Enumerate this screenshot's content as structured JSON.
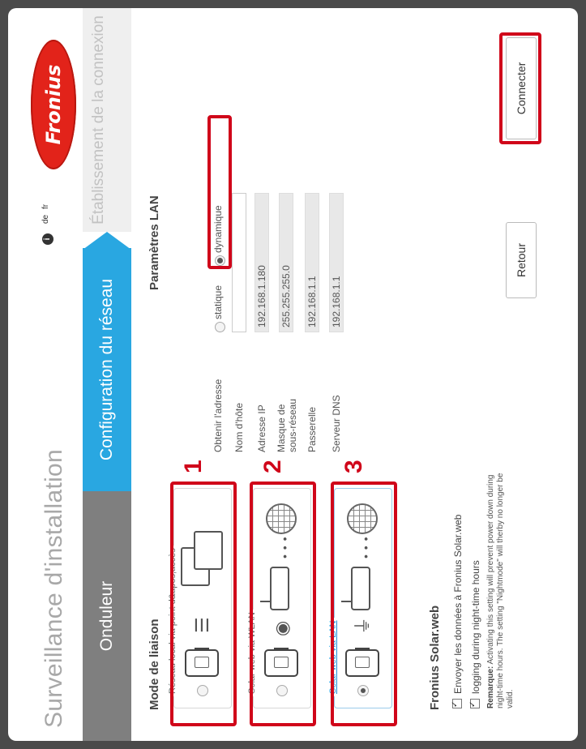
{
  "header": {
    "title": "Surveillance d'installation",
    "info_icon": "info-icon",
    "languages": [
      "de",
      "fr"
    ],
    "logo_text": "Fronius"
  },
  "tabs": {
    "inverter": "Onduleur",
    "network_config": "Configuration du réseau",
    "connection": "Établissement de la connexion"
  },
  "link_mode": {
    "title": "Mode de liaison",
    "options": [
      {
        "label": "Réseau local via point d&apos;accès",
        "selected": false,
        "number": "1"
      },
      {
        "label": "Solar web via WLAN",
        "selected": false,
        "number": "2"
      },
      {
        "label": "Solar web via LAN",
        "selected": true,
        "number": "3"
      }
    ]
  },
  "lan_params": {
    "title": "Paramètres LAN",
    "obtain_label": "Obtenir l'adresse",
    "obtain_options": [
      "statique",
      "dynamique"
    ],
    "obtain_selected": "dynamique",
    "fields": [
      {
        "label": "Nom d'hôte",
        "value": ""
      },
      {
        "label": "Adresse IP",
        "value": "192.168.1.180"
      },
      {
        "label": "Masque de sous-réseau",
        "value": "255.255.255.0"
      },
      {
        "label": "Passerelle",
        "value": "192.168.1.1"
      },
      {
        "label": "Serveur DNS",
        "value": "192.168.1.1"
      }
    ]
  },
  "solarweb": {
    "title": "Fronius Solar.web",
    "checkboxes": [
      {
        "label": "Envoyer les données à Fronius Solar.web",
        "checked": true
      },
      {
        "label": "logging during night-time hours",
        "checked": true
      }
    ],
    "remark_label": "Remarque:",
    "remark_text": "Activating this setting will prevent power down during night-time hours. The setting \"Nightmode\" will therby no longer be valid."
  },
  "buttons": {
    "back": "Retour",
    "connect": "Connecter"
  }
}
